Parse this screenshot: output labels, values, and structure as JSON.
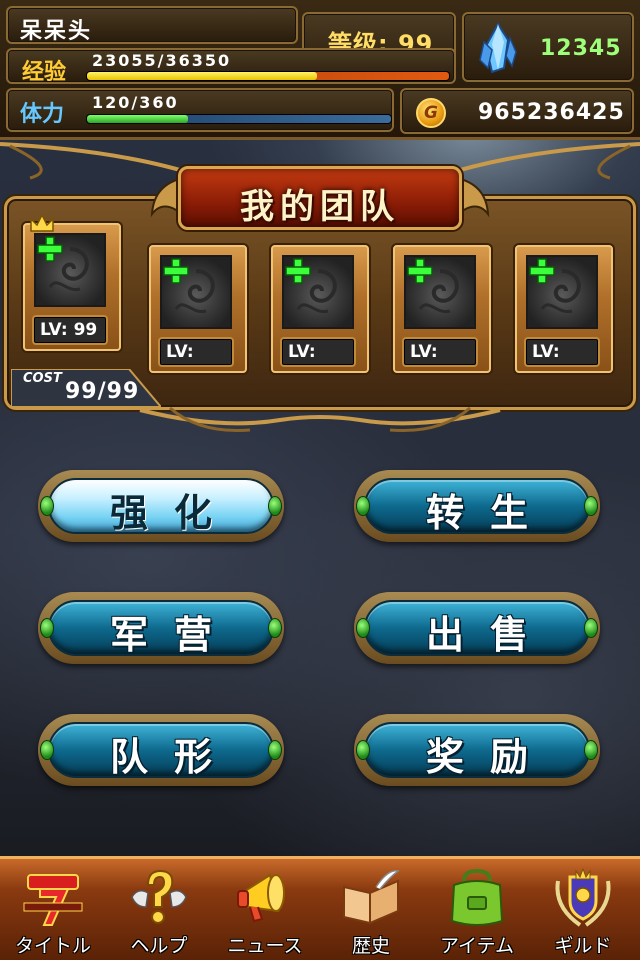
{
  "player": {
    "name": "呆呆头",
    "level_text": "等级: 99",
    "exp_label": "经验",
    "exp_value": "23055/36350",
    "exp_progress": 0.634,
    "stamina_label": "体力",
    "stamina_value": "120/360",
    "stamina_progress": 0.333,
    "gems": "12345",
    "gold_icon_letter": "G",
    "gold": "965236425"
  },
  "team": {
    "title": "我的团队",
    "slots": [
      {
        "lv_label": "LV: 99",
        "leader": true
      },
      {
        "lv_label": "LV:",
        "leader": false
      },
      {
        "lv_label": "LV:",
        "leader": false
      },
      {
        "lv_label": "LV:",
        "leader": false
      },
      {
        "lv_label": "LV:",
        "leader": false
      }
    ],
    "cost_label": "COST",
    "cost_value": "99/99"
  },
  "menu": {
    "enhance": "强化",
    "rebirth": "转生",
    "barracks": "军营",
    "sell": "出售",
    "formation": "队形",
    "reward": "奖励"
  },
  "nav": {
    "items": [
      {
        "label": "タイトル",
        "icon": "seven-logo-icon"
      },
      {
        "label": "ヘルプ",
        "icon": "question-icon"
      },
      {
        "label": "ニュース",
        "icon": "megaphone-icon"
      },
      {
        "label": "歴史",
        "icon": "book-icon"
      },
      {
        "label": "アイテム",
        "icon": "bag-icon"
      },
      {
        "label": "ギルド",
        "icon": "guild-emblem-icon"
      }
    ]
  },
  "colors": {
    "gold_text": "#ffdd66",
    "gem_text": "#9dff7a",
    "button_blue": "#0e6a8e",
    "nav_orange": "#c86a2a"
  }
}
